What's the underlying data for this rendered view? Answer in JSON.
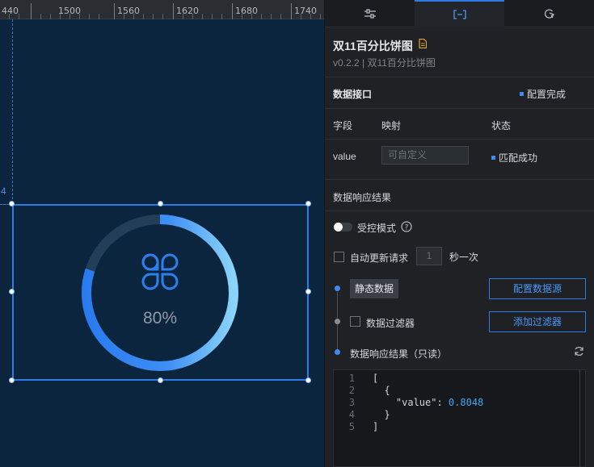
{
  "ruler": {
    "ticks": [
      "440",
      "1500",
      "1560",
      "1620",
      "1680",
      "1740"
    ]
  },
  "canvas": {
    "guide_number": "4",
    "widget_value": "80%"
  },
  "panel": {
    "tabs": [
      {
        "icon": "sliders-icon",
        "active": false
      },
      {
        "icon": "data-bracket-icon",
        "active": true
      },
      {
        "icon": "interaction-icon",
        "active": false
      }
    ],
    "component_title": "双11百分比饼图",
    "component_version": "v0.2.2 | 双11百分比饼图",
    "data_interface": {
      "title": "数据接口",
      "status": "配置完成"
    },
    "field_table": {
      "headers": [
        "字段",
        "映射",
        "状态"
      ],
      "rows": [
        {
          "field": "value",
          "mapping_placeholder": "可自定义",
          "status": "匹配成功"
        }
      ]
    },
    "response_section_title": "数据响应结果",
    "controlled_mode_label": "受控模式",
    "auto_update_label": "自动更新请求",
    "auto_update_interval": "1",
    "auto_update_suffix": "秒一次",
    "static_data_label": "静态数据",
    "config_source_button": "配置数据源",
    "filter_label": "数据过滤器",
    "add_filter_button": "添加过滤器",
    "response_readonly_label": "数据响应结果（只读）",
    "code": {
      "line_numbers": [
        "1",
        "2",
        "3",
        "4",
        "5"
      ],
      "lines": [
        "[",
        "  {",
        "    \"value\": ",
        "  }",
        "]"
      ],
      "value": "0.8048"
    }
  },
  "colors": {
    "accent": "#2f7be6",
    "canvas_bg": "#0c253f",
    "panel_bg": "#1f2125"
  }
}
